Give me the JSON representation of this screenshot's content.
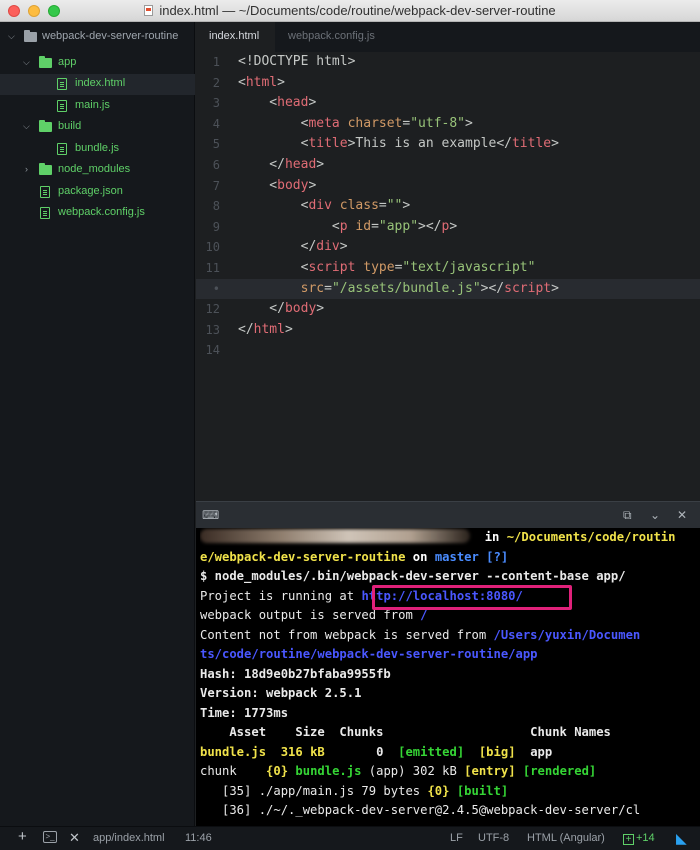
{
  "window": {
    "title": "index.html — ~/Documents/code/routine/webpack-dev-server-routine"
  },
  "sidebar": {
    "root": "webpack-dev-server-routine",
    "items": [
      {
        "label": "app"
      },
      {
        "label": "index.html"
      },
      {
        "label": "main.js"
      },
      {
        "label": "build"
      },
      {
        "label": "bundle.js"
      },
      {
        "label": "node_modules"
      },
      {
        "label": "package.json"
      },
      {
        "label": "webpack.config.js"
      }
    ]
  },
  "tabs": [
    {
      "label": "index.html"
    },
    {
      "label": "webpack.config.js"
    }
  ],
  "editor": {
    "line_numbers": [
      "1",
      "2",
      "3",
      "4",
      "5",
      "6",
      "7",
      "8",
      "9",
      "10",
      "11",
      "•",
      "12",
      "13",
      "14"
    ],
    "lines": [
      {
        "p": [
          "<!DOCTYPE html>"
        ]
      },
      {
        "p": [
          "<",
          "html",
          ">"
        ]
      },
      {
        "p": [
          "    <",
          "head",
          ">"
        ]
      },
      {
        "p": [
          "        <",
          "meta",
          " ",
          "charset",
          "=",
          "\"utf-8\"",
          ">"
        ]
      },
      {
        "p": [
          "        <",
          "title",
          ">",
          "This is an example",
          "</",
          "title",
          ">"
        ]
      },
      {
        "p": [
          "    </",
          "head",
          ">"
        ]
      },
      {
        "p": [
          "    <",
          "body",
          ">"
        ]
      },
      {
        "p": [
          "        <",
          "div",
          " ",
          "class",
          "=",
          "\"\"",
          ">"
        ]
      },
      {
        "p": [
          "            <",
          "p",
          " ",
          "id",
          "=",
          "\"app\"",
          "></",
          "p",
          ">"
        ]
      },
      {
        "p": [
          "        </",
          "div",
          ">"
        ]
      },
      {
        "p": [
          "        <",
          "script",
          " ",
          "type",
          "=",
          "\"text/javascript\""
        ]
      },
      {
        "p": [
          "        ",
          "src",
          "=",
          "\"/assets/bundle.js\"",
          "></",
          "script",
          ">"
        ]
      },
      {
        "p": [
          "    </",
          "body",
          ">"
        ]
      },
      {
        "p": [
          "</",
          "html",
          ">"
        ]
      },
      {
        "p": [
          ""
        ]
      }
    ]
  },
  "terminal": {
    "l1_in": "in",
    "l1_path": " ~/Documents/code/routin",
    "l2_path": "e/webpack-dev-server-routine",
    "l2_on": " on ",
    "l2_branch": "master",
    "l2_status": " [?]",
    "l3": "$ node_modules/.bin/webpack-dev-server --content-base app/",
    "l4_prefix": "Project is running at ",
    "l4_url": "http://localhost:8080/",
    "l5_prefix": "webpack output is served from ",
    "l5_path": "/",
    "l6_prefix": "Content not from webpack is served from ",
    "l6_path": "/Users/yuxin/Documen",
    "l7_path": "ts/code/routine/webpack-dev-server-routine/app",
    "l8": "Hash: 18d9e0b27bfaba9955fb",
    "l9": "Version: webpack 2.5.1",
    "l10": "Time: 1773ms",
    "l11_header": "    Asset    Size  Chunks                    Chunk Names",
    "l12_asset": "bundle.js",
    "l12_size": "  316 kB",
    "l12_chunk": "       0  ",
    "l12_emitted": "[emitted]",
    "l12_big": "  [big]",
    "l12_name": "  app",
    "l13_prefix": "chunk    ",
    "l13_id": "{0}",
    "l13_file": " bundle.js",
    "l13_mid": " (app) 302 kB ",
    "l13_entry": "[entry]",
    "l13_rendered": " [rendered]",
    "l14_prefix": "   [35] ./app/main.js 79 bytes ",
    "l14_id": "{0}",
    "l14_built": " [built]",
    "l15": "   [36] ./~/._webpack-dev-server@2.4.5@webpack-dev-server/cl"
  },
  "status": {
    "path": "app/index.html",
    "position": "11:46",
    "line_ending": "LF",
    "encoding": "UTF-8",
    "grammar": "HTML (Angular)",
    "git_added": "+14"
  },
  "colors": {
    "sidebar_green": "#5fd068",
    "highlight_box": "#e0217a",
    "terminal_blue": "#4a57ff"
  }
}
